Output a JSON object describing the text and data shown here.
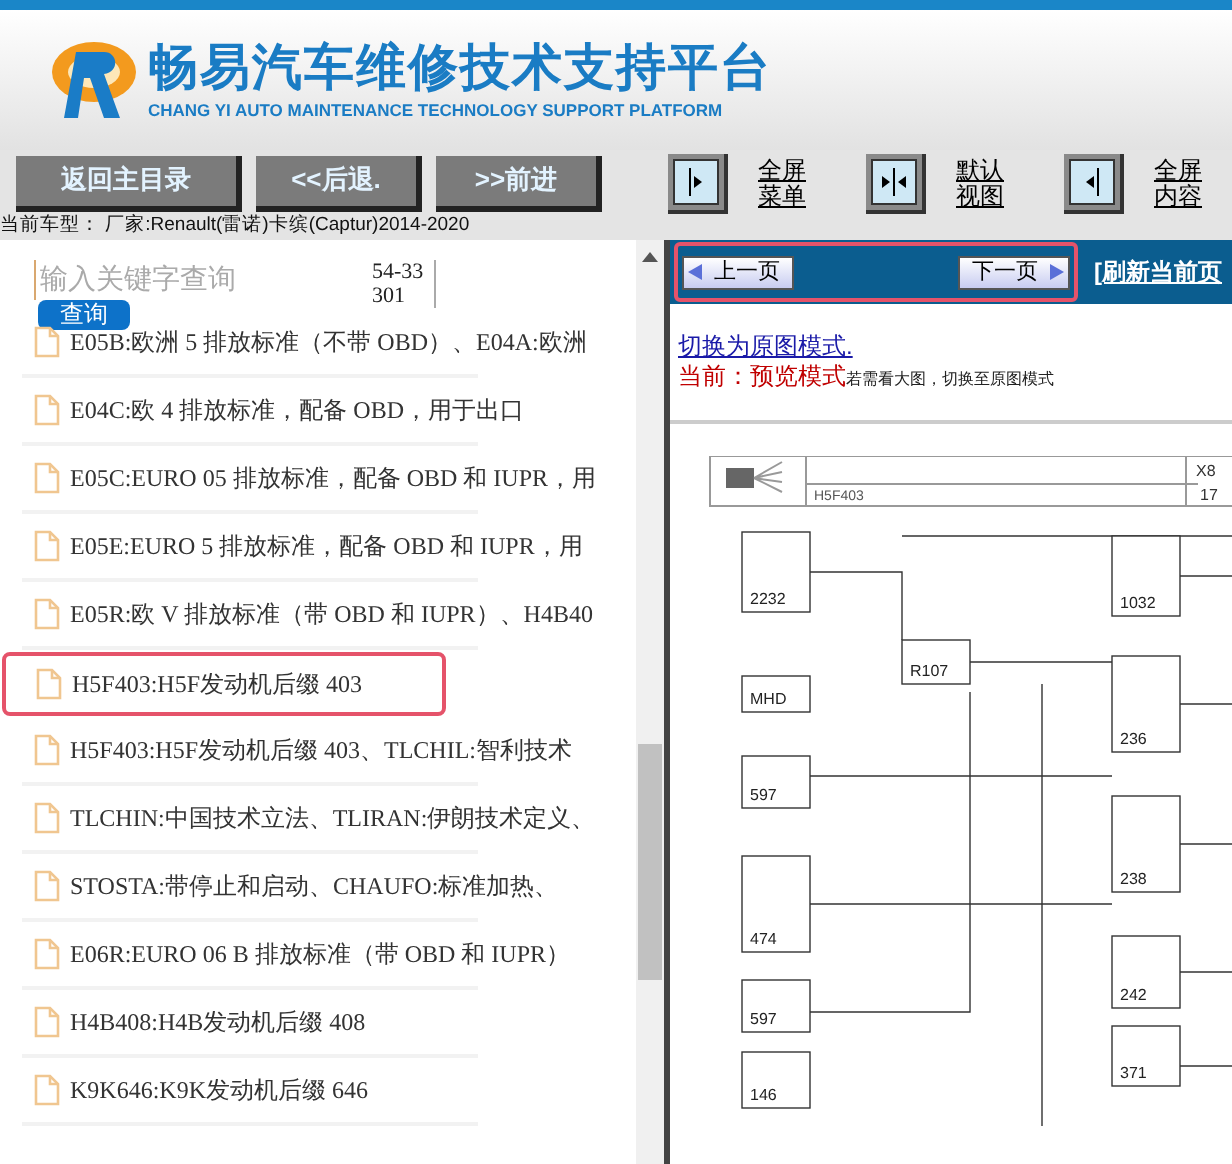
{
  "header": {
    "title": "畅易汽车维修技术支持平台",
    "subtitle": "CHANG YI AUTO MAINTENANCE TECHNOLOGY SUPPORT PLATFORM"
  },
  "toolbar": {
    "buttons": [
      "返回主目录",
      "<<后退.",
      ">>前进"
    ],
    "view_buttons": [
      {
        "kind": "right",
        "label_lines": [
          "全屏",
          "菜单"
        ]
      },
      {
        "kind": "center",
        "label_lines": [
          "默认",
          "视图"
        ]
      },
      {
        "kind": "left",
        "label_lines": [
          "全屏",
          "内容"
        ]
      }
    ]
  },
  "vehicle_line": "当前车型： 厂家:Renault(雷诺)卡缤(Captur)2014-2020",
  "search": {
    "placeholder": "输入关键字查询",
    "button": "查询",
    "code": "54-33301"
  },
  "list_items": [
    {
      "text": "E05B:欧洲 5 排放标准（不带 OBD）、E04A:欧洲",
      "highlighted": false
    },
    {
      "text": "E04C:欧 4 排放标准，配备 OBD，用于出口",
      "highlighted": false
    },
    {
      "text": "E05C:EURO 05 排放标准，配备 OBD 和 IUPR，用",
      "highlighted": false
    },
    {
      "text": "E05E:EURO 5 排放标准，配备 OBD 和 IUPR，用",
      "highlighted": false
    },
    {
      "text": "E05R:欧 V 排放标准（带 OBD 和 IUPR）、H4B40",
      "highlighted": false
    },
    {
      "text": "H5F403:H5F发动机后缀 403",
      "highlighted": true
    },
    {
      "text": "H5F403:H5F发动机后缀 403、TLCHIL:智利技术",
      "highlighted": false
    },
    {
      "text": "TLCHIN:中国技术立法、TLIRAN:伊朗技术定义、",
      "highlighted": false
    },
    {
      "text": "STOSTA:带停止和启动、CHAUFO:标准加热、",
      "highlighted": false
    },
    {
      "text": "E06R:EURO 06 B 排放标准（带 OBD 和 IUPR）",
      "highlighted": false
    },
    {
      "text": "H4B408:H4B发动机后缀 408",
      "highlighted": false
    },
    {
      "text": "K9K646:K9K发动机后缀 646",
      "highlighted": false
    }
  ],
  "nav": {
    "prev": "上一页",
    "next": "下一页",
    "highlighted": true,
    "refresh": "[刷新当前页"
  },
  "mode": {
    "switch_link": "切换为原图模式.",
    "current": "当前：预览模式",
    "hint": "若需看大图，切换至原图模式"
  },
  "diagram": {
    "connector": "H5F403",
    "pin_header": [
      "X8",
      "17"
    ],
    "components": [
      "2232",
      "1032",
      "R107",
      "MHD",
      "236",
      "597",
      "238",
      "474",
      "242",
      "597",
      "371",
      "146"
    ]
  }
}
